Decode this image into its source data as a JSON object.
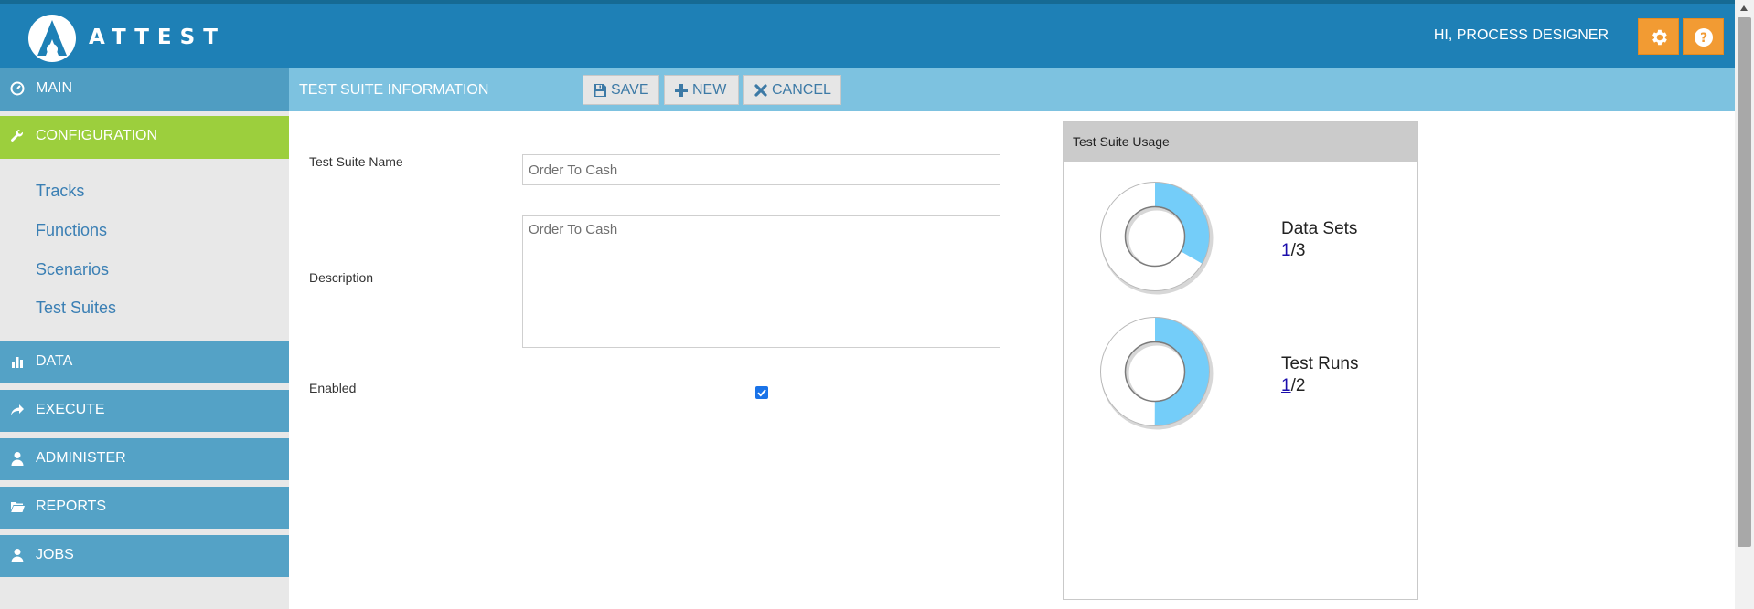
{
  "header": {
    "logo_text": "ATTEST",
    "greeting": "HI, PROCESS DESIGNER",
    "settings_icon": "gear-icon",
    "help_icon": "question-circle-icon",
    "accent_color": "#f29b33",
    "bar_color": "#1e80b6"
  },
  "sidebar": {
    "main": {
      "label": "MAIN",
      "icon": "dashboard-icon"
    },
    "configuration": {
      "label": "CONFIGURATION",
      "icon": "wrench-icon",
      "active_color": "#9ccf3d"
    },
    "sub_items": [
      {
        "label": "Tracks"
      },
      {
        "label": "Functions"
      },
      {
        "label": "Scenarios"
      },
      {
        "label": "Test Suites"
      }
    ],
    "sections": [
      {
        "label": "DATA",
        "icon": "bar-chart-icon"
      },
      {
        "label": "EXECUTE",
        "icon": "share-arrow-icon"
      },
      {
        "label": "ADMINISTER",
        "icon": "user-icon"
      },
      {
        "label": "REPORTS",
        "icon": "folder-open-icon"
      },
      {
        "label": "JOBS",
        "icon": "user-icon"
      }
    ]
  },
  "toolbar": {
    "title": "TEST SUITE INFORMATION",
    "save_label": "SAVE",
    "new_label": "NEW",
    "cancel_label": "CANCEL"
  },
  "form": {
    "name_label": "Test Suite Name",
    "name_value": "Order To Cash",
    "description_label": "Description",
    "description_value": "Order To Cash",
    "enabled_label": "Enabled",
    "enabled_checked": true
  },
  "usage": {
    "title": "Test Suite Usage",
    "data_sets": {
      "label": "Data Sets",
      "used": "1",
      "total": "/3",
      "fraction": 0.333
    },
    "test_runs": {
      "label": "Test Runs",
      "used": "1",
      "total": "/2",
      "fraction": 0.5
    },
    "ring_color": "#74cdf9"
  }
}
